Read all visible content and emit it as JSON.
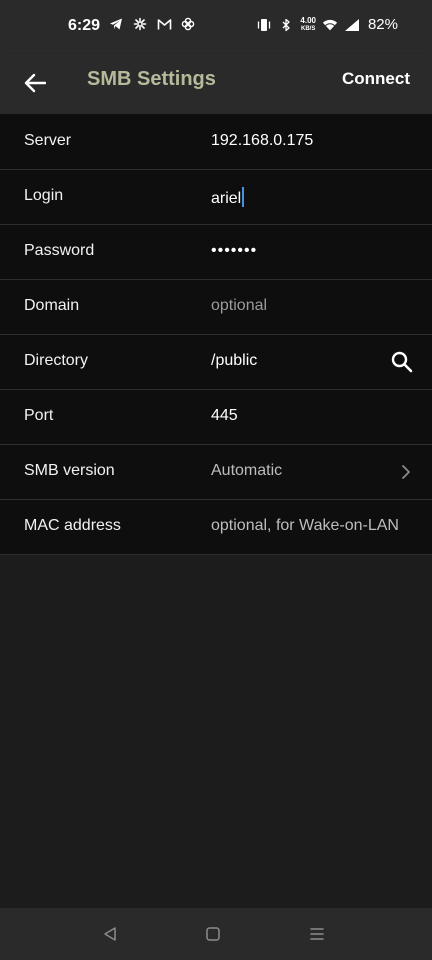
{
  "status_bar": {
    "time": "6:29",
    "net_speed_value": "4.00",
    "net_speed_unit": "KB/S",
    "battery": "82%",
    "left_icons": [
      "telegram-icon",
      "pinwheel-icon",
      "gmail-icon",
      "fan-icon"
    ],
    "right_icons": [
      "vibrate-icon",
      "bluetooth-icon",
      "wifi-icon",
      "signal-icon"
    ]
  },
  "app_bar": {
    "title": "SMB Settings",
    "connect_label": "Connect",
    "title_color": "#b6b99a"
  },
  "settings": [
    {
      "key": "server",
      "label": "Server",
      "value": "192.168.0.175",
      "kind": "value"
    },
    {
      "key": "login",
      "label": "Login",
      "value": "ariel",
      "kind": "value"
    },
    {
      "key": "password",
      "label": "Password",
      "value": "•••••••",
      "kind": "value"
    },
    {
      "key": "domain",
      "label": "Domain",
      "value": "optional",
      "kind": "placeholder"
    },
    {
      "key": "directory",
      "label": "Directory",
      "value": "/public",
      "kind": "value"
    },
    {
      "key": "port",
      "label": "Port",
      "value": "445",
      "kind": "value"
    },
    {
      "key": "smb_version",
      "label": "SMB version",
      "value": "Automatic",
      "kind": "select"
    },
    {
      "key": "mac_address",
      "label": "MAC address",
      "value": "optional, for Wake-on-LAN",
      "kind": "placeholder"
    }
  ],
  "nav": {
    "buttons": [
      "back-nav-icon",
      "home-nav-icon",
      "recents-nav-icon"
    ]
  }
}
